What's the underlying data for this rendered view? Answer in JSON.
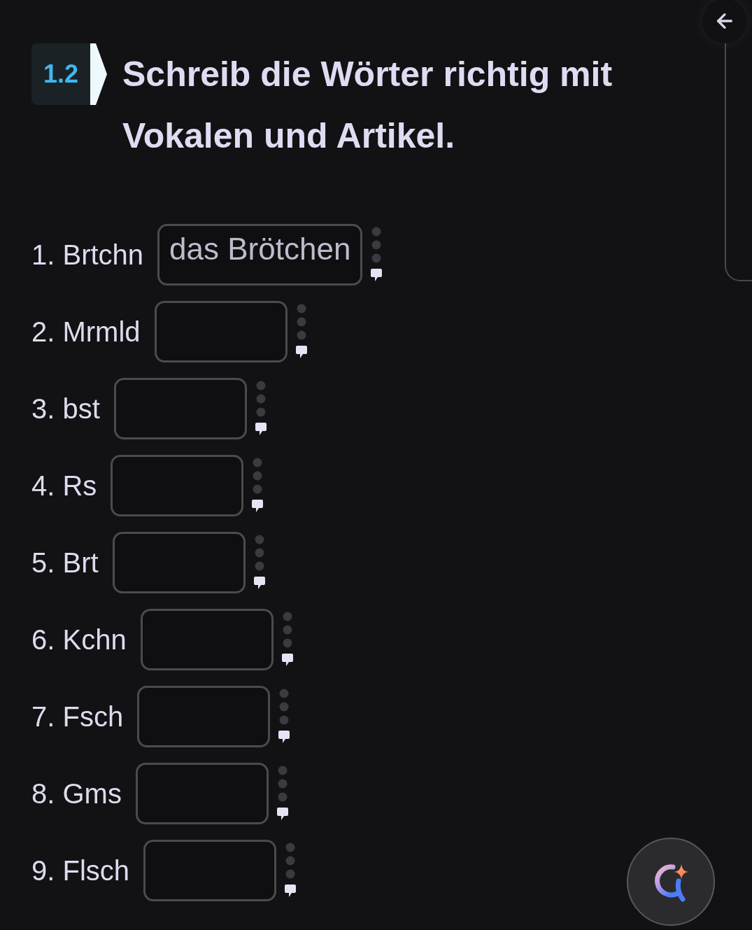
{
  "exercise": {
    "number": "1.2",
    "title": "Schreib die Wörter richtig mit Vokalen und Artikel."
  },
  "items": [
    {
      "prompt": "1. Brtchn",
      "answer": "das Brötchen"
    },
    {
      "prompt": "2. Mrmld"
    },
    {
      "prompt": "3. bst"
    },
    {
      "prompt": "4. Rs"
    },
    {
      "prompt": "5. Brt"
    },
    {
      "prompt": "6. Kchn"
    },
    {
      "prompt": "7. Fsch"
    },
    {
      "prompt": "8. Gms"
    },
    {
      "prompt": "9. Flsch"
    }
  ]
}
